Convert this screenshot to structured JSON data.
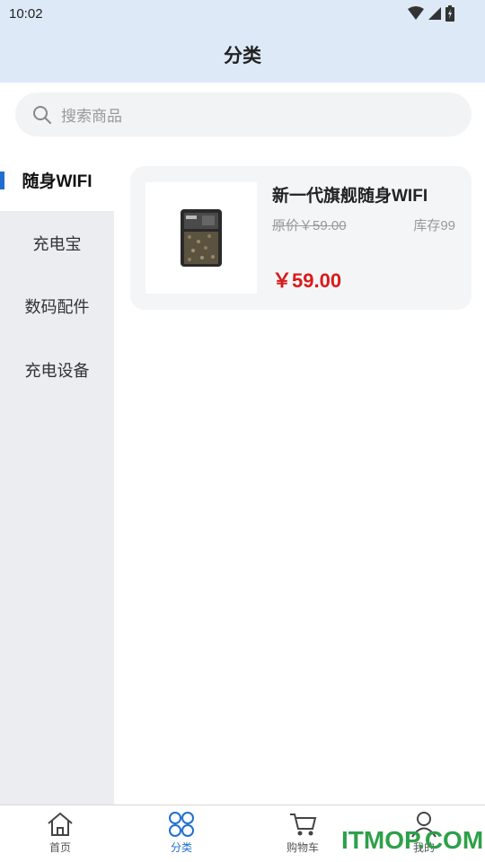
{
  "status_bar": {
    "time": "10:02"
  },
  "header": {
    "title": "分类"
  },
  "search": {
    "placeholder": "搜索商品"
  },
  "sidebar": {
    "items": [
      {
        "label": "随身WIFI",
        "active": true
      },
      {
        "label": "充电宝",
        "active": false
      },
      {
        "label": "数码配件",
        "active": false
      },
      {
        "label": "充电设备",
        "active": false
      }
    ]
  },
  "product": {
    "name": "新一代旗舰随身WIFI",
    "original_price": "原价￥59.00",
    "stock": "库存99",
    "price": "￥59.00"
  },
  "tabbar": {
    "items": [
      {
        "label": "首页",
        "icon": "home-icon"
      },
      {
        "label": "分类",
        "icon": "category-icon"
      },
      {
        "label": "购物车",
        "icon": "cart-icon"
      },
      {
        "label": "我的",
        "icon": "user-icon"
      }
    ]
  },
  "watermark": {
    "text": "ITMOP.COM"
  },
  "colors": {
    "accent": "#1f6fd1",
    "price": "#d91a1a",
    "header_bg": "#dde9f7",
    "sidebar_bg": "#ecedf1"
  }
}
